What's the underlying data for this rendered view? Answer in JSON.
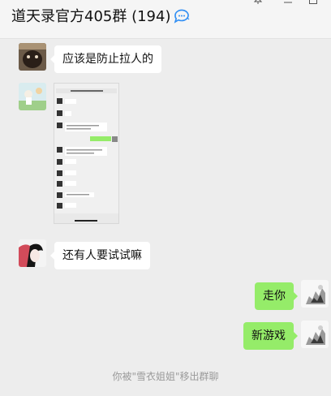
{
  "header": {
    "title": "道天录官方405群 (194)",
    "chat_icon": "chat-bubble-icon",
    "window_controls": [
      "pin-icon",
      "minimize-icon",
      "maximize-icon"
    ]
  },
  "messages": [
    {
      "side": "left",
      "type": "text",
      "text": "应该是防止拉人的"
    },
    {
      "side": "left",
      "type": "image"
    },
    {
      "side": "left",
      "type": "text",
      "text": "还有人要试试嘛"
    },
    {
      "side": "right",
      "type": "text",
      "text": "走你"
    },
    {
      "side": "right",
      "type": "text",
      "text": "新游戏"
    }
  ],
  "system_note": "你被\"雪衣姐姐\"移出群聊",
  "colors": {
    "background": "#ededed",
    "bubble_self": "#95ec69",
    "bubble_other": "#ffffff",
    "system_text": "#9a9a9a"
  }
}
